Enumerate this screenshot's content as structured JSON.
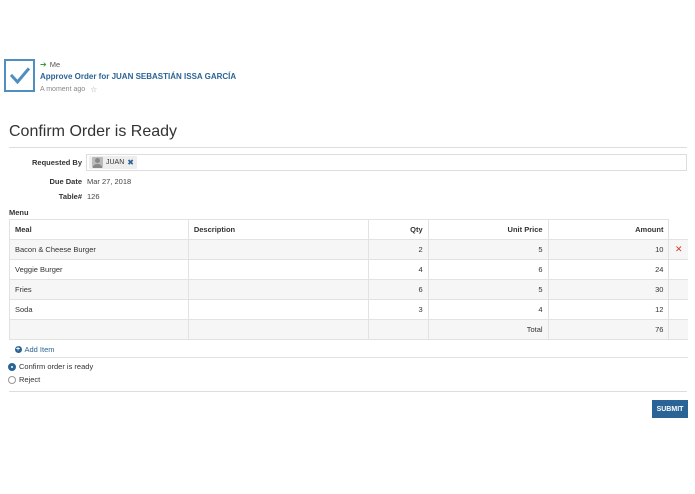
{
  "activity": {
    "from": "Me",
    "task_title": "Approve Order for JUAN SEBASTIÁN ISSA GARCÍA",
    "time": "A moment ago",
    "task_icon": "check-icon",
    "accent": "#4f8fbf"
  },
  "page": {
    "title": "Confirm Order is Ready"
  },
  "form": {
    "requested_by_label": "Requested By",
    "requested_by_user": "JUAN",
    "due_date_label": "Due Date",
    "due_date": "Mar 27, 2018",
    "table_label": "Table#",
    "table_value": "126"
  },
  "menu": {
    "label": "Menu",
    "columns": {
      "meal": "Meal",
      "description": "Description",
      "qty": "Qty",
      "unit_price": "Unit Price",
      "amount": "Amount"
    },
    "rows": [
      {
        "meal": "Bacon & Cheese Burger",
        "description": "",
        "qty": "2",
        "unit_price": "5",
        "amount": "10"
      },
      {
        "meal": "Veggie Burger",
        "description": "",
        "qty": "4",
        "unit_price": "6",
        "amount": "24"
      },
      {
        "meal": "Fries",
        "description": "",
        "qty": "6",
        "unit_price": "5",
        "amount": "30"
      },
      {
        "meal": "Soda",
        "description": "",
        "qty": "3",
        "unit_price": "4",
        "amount": "12"
      }
    ],
    "total_label": "Total",
    "total_value": "76",
    "add_item_label": "Add Item"
  },
  "decision": {
    "options": [
      {
        "label": "Confirm order is ready",
        "checked": true
      },
      {
        "label": "Reject",
        "checked": false
      }
    ]
  },
  "actions": {
    "submit_label": "SUBMIT",
    "primary_color": "#2a6496",
    "danger_color": "#d9342b"
  }
}
